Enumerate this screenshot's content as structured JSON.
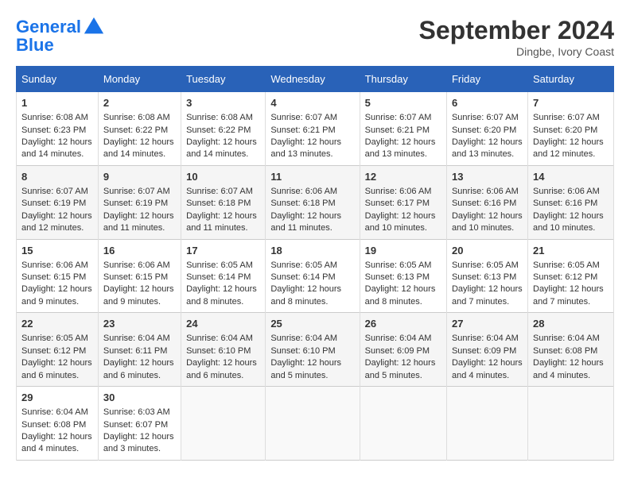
{
  "header": {
    "logo_line1": "General",
    "logo_line2": "Blue",
    "month": "September 2024",
    "location": "Dingbe, Ivory Coast"
  },
  "weekdays": [
    "Sunday",
    "Monday",
    "Tuesday",
    "Wednesday",
    "Thursday",
    "Friday",
    "Saturday"
  ],
  "weeks": [
    [
      {
        "day": "1",
        "sunrise": "6:08 AM",
        "sunset": "6:23 PM",
        "daylight": "12 hours and 14 minutes."
      },
      {
        "day": "2",
        "sunrise": "6:08 AM",
        "sunset": "6:22 PM",
        "daylight": "12 hours and 14 minutes."
      },
      {
        "day": "3",
        "sunrise": "6:08 AM",
        "sunset": "6:22 PM",
        "daylight": "12 hours and 14 minutes."
      },
      {
        "day": "4",
        "sunrise": "6:07 AM",
        "sunset": "6:21 PM",
        "daylight": "12 hours and 13 minutes."
      },
      {
        "day": "5",
        "sunrise": "6:07 AM",
        "sunset": "6:21 PM",
        "daylight": "12 hours and 13 minutes."
      },
      {
        "day": "6",
        "sunrise": "6:07 AM",
        "sunset": "6:20 PM",
        "daylight": "12 hours and 13 minutes."
      },
      {
        "day": "7",
        "sunrise": "6:07 AM",
        "sunset": "6:20 PM",
        "daylight": "12 hours and 12 minutes."
      }
    ],
    [
      {
        "day": "8",
        "sunrise": "6:07 AM",
        "sunset": "6:19 PM",
        "daylight": "12 hours and 12 minutes."
      },
      {
        "day": "9",
        "sunrise": "6:07 AM",
        "sunset": "6:19 PM",
        "daylight": "12 hours and 11 minutes."
      },
      {
        "day": "10",
        "sunrise": "6:07 AM",
        "sunset": "6:18 PM",
        "daylight": "12 hours and 11 minutes."
      },
      {
        "day": "11",
        "sunrise": "6:06 AM",
        "sunset": "6:18 PM",
        "daylight": "12 hours and 11 minutes."
      },
      {
        "day": "12",
        "sunrise": "6:06 AM",
        "sunset": "6:17 PM",
        "daylight": "12 hours and 10 minutes."
      },
      {
        "day": "13",
        "sunrise": "6:06 AM",
        "sunset": "6:16 PM",
        "daylight": "12 hours and 10 minutes."
      },
      {
        "day": "14",
        "sunrise": "6:06 AM",
        "sunset": "6:16 PM",
        "daylight": "12 hours and 10 minutes."
      }
    ],
    [
      {
        "day": "15",
        "sunrise": "6:06 AM",
        "sunset": "6:15 PM",
        "daylight": "12 hours and 9 minutes."
      },
      {
        "day": "16",
        "sunrise": "6:06 AM",
        "sunset": "6:15 PM",
        "daylight": "12 hours and 9 minutes."
      },
      {
        "day": "17",
        "sunrise": "6:05 AM",
        "sunset": "6:14 PM",
        "daylight": "12 hours and 8 minutes."
      },
      {
        "day": "18",
        "sunrise": "6:05 AM",
        "sunset": "6:14 PM",
        "daylight": "12 hours and 8 minutes."
      },
      {
        "day": "19",
        "sunrise": "6:05 AM",
        "sunset": "6:13 PM",
        "daylight": "12 hours and 8 minutes."
      },
      {
        "day": "20",
        "sunrise": "6:05 AM",
        "sunset": "6:13 PM",
        "daylight": "12 hours and 7 minutes."
      },
      {
        "day": "21",
        "sunrise": "6:05 AM",
        "sunset": "6:12 PM",
        "daylight": "12 hours and 7 minutes."
      }
    ],
    [
      {
        "day": "22",
        "sunrise": "6:05 AM",
        "sunset": "6:12 PM",
        "daylight": "12 hours and 6 minutes."
      },
      {
        "day": "23",
        "sunrise": "6:04 AM",
        "sunset": "6:11 PM",
        "daylight": "12 hours and 6 minutes."
      },
      {
        "day": "24",
        "sunrise": "6:04 AM",
        "sunset": "6:10 PM",
        "daylight": "12 hours and 6 minutes."
      },
      {
        "day": "25",
        "sunrise": "6:04 AM",
        "sunset": "6:10 PM",
        "daylight": "12 hours and 5 minutes."
      },
      {
        "day": "26",
        "sunrise": "6:04 AM",
        "sunset": "6:09 PM",
        "daylight": "12 hours and 5 minutes."
      },
      {
        "day": "27",
        "sunrise": "6:04 AM",
        "sunset": "6:09 PM",
        "daylight": "12 hours and 4 minutes."
      },
      {
        "day": "28",
        "sunrise": "6:04 AM",
        "sunset": "6:08 PM",
        "daylight": "12 hours and 4 minutes."
      }
    ],
    [
      {
        "day": "29",
        "sunrise": "6:04 AM",
        "sunset": "6:08 PM",
        "daylight": "12 hours and 4 minutes."
      },
      {
        "day": "30",
        "sunrise": "6:03 AM",
        "sunset": "6:07 PM",
        "daylight": "12 hours and 3 minutes."
      },
      null,
      null,
      null,
      null,
      null
    ]
  ]
}
